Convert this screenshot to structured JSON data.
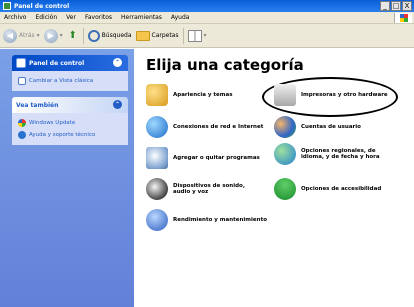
{
  "window": {
    "title": "Panel de control",
    "controls": [
      "_",
      "□",
      "X"
    ]
  },
  "menubar": [
    "Archivo",
    "Edición",
    "Ver",
    "Favoritos",
    "Herramientas",
    "Ayuda"
  ],
  "toolbar": {
    "back": "Atrás",
    "search": "Búsqueda",
    "folders": "Carpetas"
  },
  "sidebar": {
    "panel1": {
      "title": "Panel de control",
      "items": [
        {
          "label": "Cambiar a Vista clásica"
        }
      ]
    },
    "panel2": {
      "title": "Vea también",
      "items": [
        {
          "label": "Windows Update"
        },
        {
          "label": "Ayuda y soporte técnico"
        }
      ]
    }
  },
  "main": {
    "heading": "Elija una categoría",
    "categories": [
      {
        "label": "Apariencia y temas"
      },
      {
        "label": "Impresoras y otro hardware"
      },
      {
        "label": "Conexiones de red e Internet"
      },
      {
        "label": "Cuentas de usuario"
      },
      {
        "label": "Agregar o quitar programas"
      },
      {
        "label": "Opciones regionales, de idioma, y de fecha y hora"
      },
      {
        "label": "Dispositivos de sonido, audio y voz"
      },
      {
        "label": "Opciones de accesibilidad"
      },
      {
        "label": "Rendimiento y mantenimiento"
      }
    ]
  },
  "colors": {
    "titlebar": "#0a5fd8",
    "sidebar": "#7aa0e6",
    "link": "#215dc6",
    "highlight_circle": "#000000"
  }
}
